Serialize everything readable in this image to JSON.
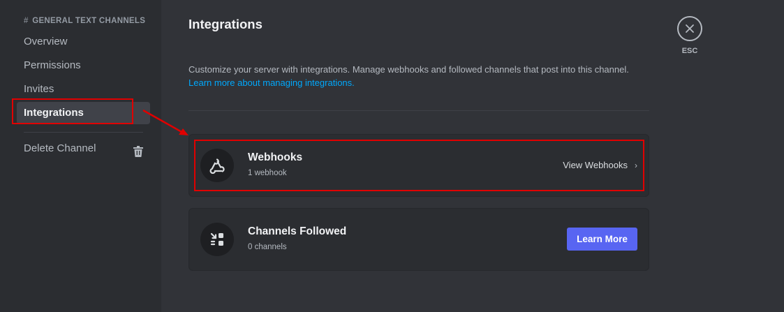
{
  "sidebar": {
    "header": "GENERAL TEXT CHANNELS",
    "header_prefix": "#",
    "items": [
      {
        "label": "Overview"
      },
      {
        "label": "Permissions"
      },
      {
        "label": "Invites"
      },
      {
        "label": "Integrations",
        "selected": true
      }
    ],
    "delete_label": "Delete Channel"
  },
  "main": {
    "title": "Integrations",
    "description": "Customize your server with integrations. Manage webhooks and followed channels that post into this channel.",
    "learn_link": "Learn more about managing integrations.",
    "cards": [
      {
        "title": "Webhooks",
        "subtitle": "1 webhook",
        "action": "View Webhooks",
        "icon": "webhook-icon"
      },
      {
        "title": "Channels Followed",
        "subtitle": "0 channels",
        "action": "Learn More",
        "icon": "channels-followed-icon"
      }
    ]
  },
  "close": {
    "label": "ESC"
  },
  "colors": {
    "accent": "#5865f2",
    "link": "#00a8fc",
    "annotation": "#e00000",
    "background": "#313338",
    "sidebar_bg": "#2b2d31"
  }
}
